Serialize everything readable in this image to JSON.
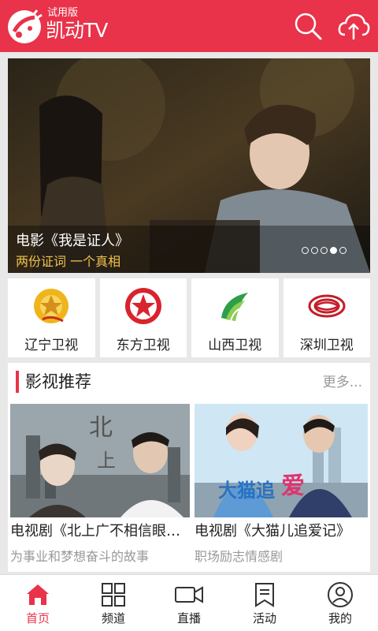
{
  "app": {
    "badge": "试用版",
    "name": "凯动TV",
    "accent": "#e8334a"
  },
  "header_icons": [
    "search-icon",
    "cloud-upload-icon"
  ],
  "banner": {
    "title": "电影《我是证人》",
    "subtitle": "两份证词 一个真相",
    "slide_count": 5,
    "active_slide": 4
  },
  "channels": [
    {
      "label": "辽宁卫视",
      "icon": "liaoning-tv-logo"
    },
    {
      "label": "东方卫视",
      "icon": "dragon-tv-logo"
    },
    {
      "label": "山西卫视",
      "icon": "shanxi-tv-logo"
    },
    {
      "label": "深圳卫视",
      "icon": "shenzhen-tv-logo"
    }
  ],
  "recommend": {
    "title": "影视推荐",
    "more": "更多...",
    "items": [
      {
        "name": "电视剧《北上广不相信眼泪》",
        "desc": "为事业和梦想奋斗的故事"
      },
      {
        "name": "电视剧《大猫儿追爱记》",
        "desc": "职场励志情感剧"
      }
    ]
  },
  "nav": [
    {
      "label": "首页",
      "icon": "home-icon",
      "active": true
    },
    {
      "label": "频道",
      "icon": "grid-icon",
      "active": false
    },
    {
      "label": "直播",
      "icon": "video-camera-icon",
      "active": false
    },
    {
      "label": "活动",
      "icon": "bookmark-icon",
      "active": false
    },
    {
      "label": "我的",
      "icon": "user-icon",
      "active": false
    }
  ]
}
